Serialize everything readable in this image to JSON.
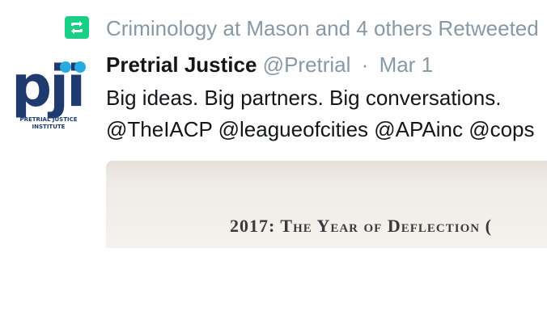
{
  "retweet": {
    "icon": "retweet-icon",
    "icon_color": "#19cf86",
    "text": "Criminology at Mason and 4 others Retweeted"
  },
  "avatar": {
    "logo_mark": "pji",
    "logo_line1": "PRETRIAL JUSTICE",
    "logo_line2": "INSTITUTE"
  },
  "tweet": {
    "author_name": "Pretrial Justice",
    "author_handle": "@Pretrial",
    "separator": "·",
    "timestamp": "Mar 1",
    "line1": "Big ideas. Big partners. Big conversations.",
    "line2": "@TheIACP @leagueofcities @APAinc @cops"
  },
  "media": {
    "caption": "2017: The Year of Deflection ("
  }
}
